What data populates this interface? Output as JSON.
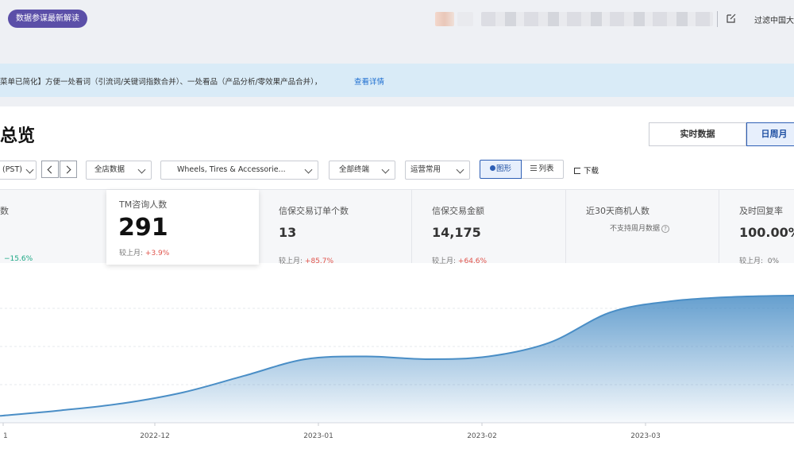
{
  "topbar": {
    "promo_label": "数据参谋最新解读",
    "filter_text": "过滤中国大"
  },
  "notice": {
    "text": "菜单已简化】方便一处看词（引流词/关键词指数合并）、一处看品（产品分析/零效果产品合并），",
    "link": "查看详情"
  },
  "page": {
    "title": "总览",
    "view_tabs": [
      "实时数据",
      "日周月"
    ]
  },
  "filters": {
    "timezone": "(PST)",
    "shop": "全店数据",
    "category": "Wheels, Tires & Accessorie...",
    "terminal": "全部终端",
    "metric_set": "运营常用",
    "graph_label": "图形",
    "list_label": "列表",
    "download_label": "下载"
  },
  "metrics": [
    {
      "label": "数",
      "value": "",
      "change_prefix": "",
      "change": "−15.6%",
      "direction": "down"
    },
    {
      "label": "TM咨询人数",
      "value": "291",
      "change_prefix": "较上月:",
      "change": "+3.9%",
      "direction": "up"
    },
    {
      "label": "信保交易订单个数",
      "value": "13",
      "change_prefix": "较上月:",
      "change": "+85.7%",
      "direction": "up"
    },
    {
      "label": "信保交易金额",
      "value": "14,175",
      "change_prefix": "较上月:",
      "change": "+64.6%",
      "direction": "up"
    },
    {
      "label": "近30天商机人数",
      "value": "",
      "note": "不支持周月数据",
      "change_prefix": "",
      "change": "",
      "direction": ""
    },
    {
      "label": "及时回复率",
      "value": "100.00%",
      "change_prefix": "较上月:",
      "change": "0%",
      "direction": "flat"
    }
  ],
  "chart_data": {
    "type": "area",
    "x_labels": [
      "1",
      "2022-12",
      "2023-01",
      "2023-02",
      "2023-03"
    ],
    "series": [
      {
        "values": [
          0.05,
          0.09,
          0.14,
          0.22,
          0.34,
          0.46,
          0.48,
          0.46,
          0.48,
          0.58,
          0.8,
          0.88,
          0.91,
          0.92
        ]
      }
    ],
    "color": "#4a8ec6"
  }
}
